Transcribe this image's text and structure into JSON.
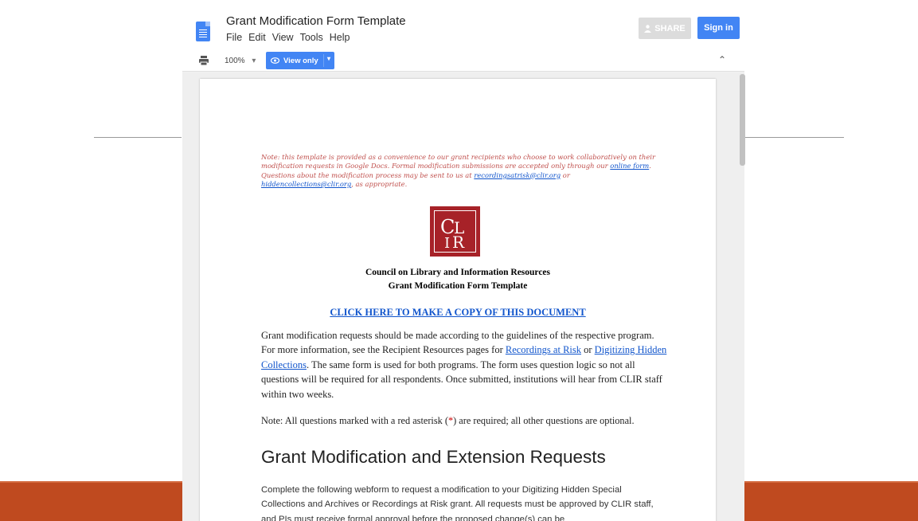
{
  "window": {
    "doc_title": "Grant Modification Form Template",
    "menu": [
      "File",
      "Edit",
      "View",
      "Tools",
      "Help"
    ],
    "share_label": "SHARE",
    "signin_label": "Sign in"
  },
  "toolbar": {
    "zoom": "100%",
    "mode_label": "View only"
  },
  "document": {
    "note_parts": {
      "a": "Note: this template is provided as a convenience to our grant recipients who choose to work collaboratively on their modification requests in Google Docs. Formal modification submissions are accepted only through our ",
      "link1": "online form",
      "b": ". Questions about the modification process may be sent to us at ",
      "link2": "recordingsatrisk@clir.org",
      "c": " or ",
      "link3": "hiddencollections@clir.org",
      "d": ", as appropriate."
    },
    "logo_text": "CLIR",
    "org_name": "Council on Library and Information Resources",
    "form_name": "Grant Modification Form Template",
    "copy_link": "CLICK HERE TO MAKE A COPY OF THIS DOCUMENT",
    "intro_parts": {
      "a": "Grant modification requests should be made according to the guidelines of the respective program. For more information, see the Recipient Resources pages for ",
      "link1": "Recordings at Risk",
      "b": " or ",
      "link2": "Digitizing Hidden Collections",
      "c": ". The same form is used for both programs. The form uses question logic so not all questions will be required for all respondents. Once submitted, institutions will hear from CLIR staff within two weeks."
    },
    "asterisk_parts": {
      "a": "Note: All questions marked with a red asterisk (",
      "star": "*",
      "b": ") are required; all other questions are optional."
    },
    "heading": "Grant Modification and Extension Requests",
    "body": "Complete the following webform to request a modification to your Digitizing Hidden Special Collections and Archives or Recordings at Risk grant. All requests must be approved by CLIR staff, and PIs must receive formal approval before the proposed change(s) can be"
  },
  "colors": {
    "accent": "#4285f4",
    "slide_band": "#bf4a1f",
    "logo": "#a72228",
    "note_text": "#c0504d",
    "link": "#1155cc"
  },
  "icons": [
    "docs-icon",
    "print-icon",
    "eye-icon",
    "chevron-up-icon",
    "person-icon"
  ]
}
